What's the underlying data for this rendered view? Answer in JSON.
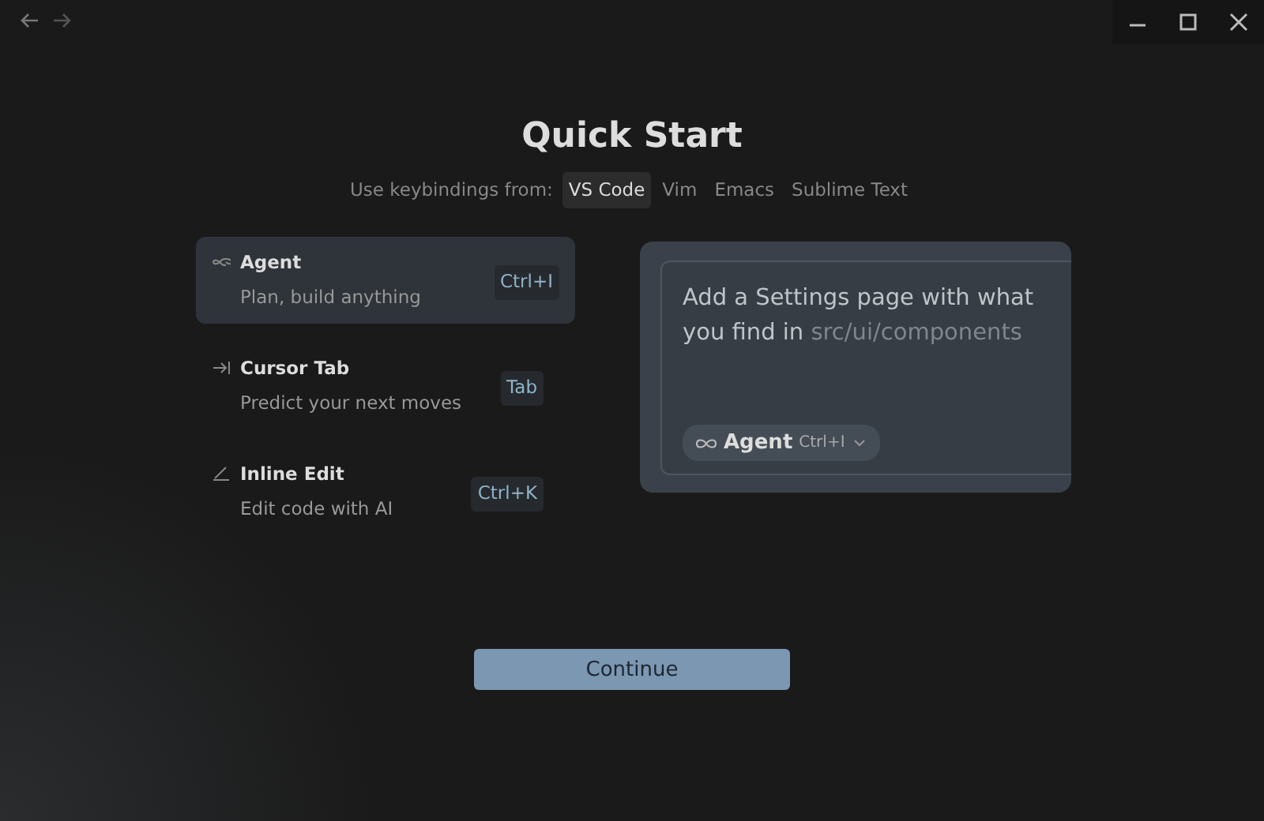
{
  "title": "Quick Start",
  "keybindings": {
    "label": "Use keybindings from:",
    "options": [
      {
        "label": "VS Code",
        "selected": true
      },
      {
        "label": "Vim",
        "selected": false
      },
      {
        "label": "Emacs",
        "selected": false
      },
      {
        "label": "Sublime Text",
        "selected": false
      }
    ]
  },
  "modes": [
    {
      "kind": "agent",
      "name": "Agent",
      "description": "Plan, build anything",
      "shortcut": "Ctrl+I",
      "selected": true
    },
    {
      "kind": "tab",
      "name": "Cursor Tab",
      "description": "Predict your next moves",
      "shortcut": "Tab",
      "selected": false
    },
    {
      "kind": "edit",
      "name": "Inline Edit",
      "description": "Edit code with AI",
      "shortcut": "Ctrl+K",
      "selected": false
    }
  ],
  "preview": {
    "prompt": "Add a Settings page with what you find in",
    "path": "src/ui/components",
    "mode": {
      "name": "Agent",
      "shortcut": "Ctrl+I"
    }
  },
  "continue_button": "Continue"
}
